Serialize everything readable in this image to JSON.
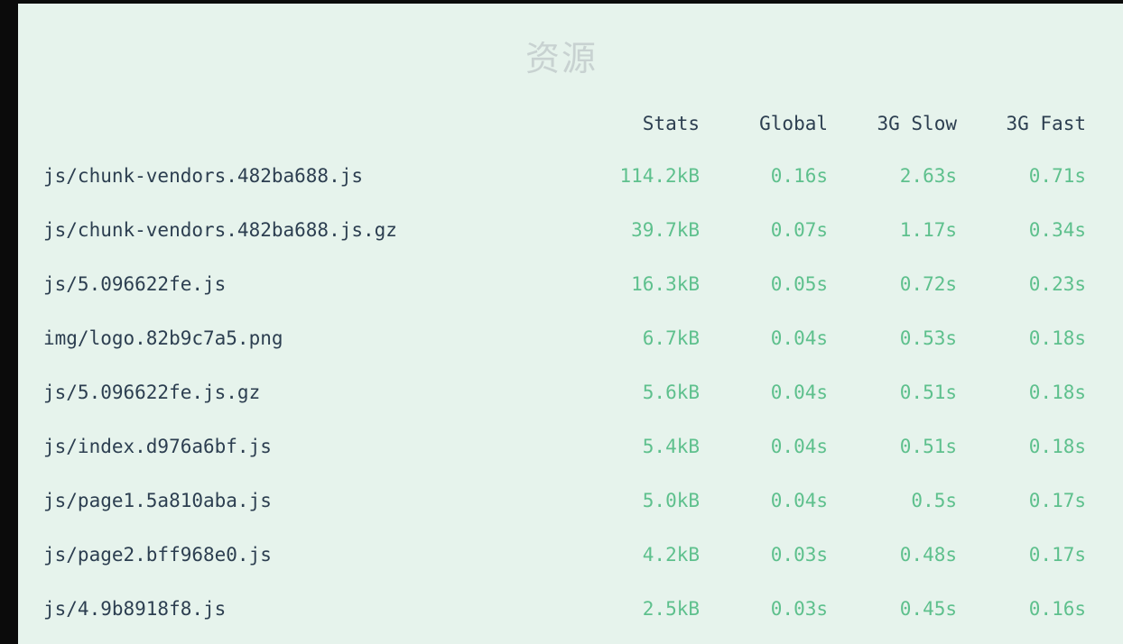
{
  "title": "资源",
  "columns": {
    "name": "",
    "stats": "Stats",
    "global": "Global",
    "slow3g": "3G Slow",
    "fast3g": "3G Fast"
  },
  "rows": [
    {
      "name": "js/chunk-vendors.482ba688.js",
      "stats": "114.2kB",
      "global": "0.16s",
      "slow3g": "2.63s",
      "fast3g": "0.71s"
    },
    {
      "name": "js/chunk-vendors.482ba688.js.gz",
      "stats": "39.7kB",
      "global": "0.07s",
      "slow3g": "1.17s",
      "fast3g": "0.34s"
    },
    {
      "name": "js/5.096622fe.js",
      "stats": "16.3kB",
      "global": "0.05s",
      "slow3g": "0.72s",
      "fast3g": "0.23s"
    },
    {
      "name": "img/logo.82b9c7a5.png",
      "stats": "6.7kB",
      "global": "0.04s",
      "slow3g": "0.53s",
      "fast3g": "0.18s"
    },
    {
      "name": "js/5.096622fe.js.gz",
      "stats": "5.6kB",
      "global": "0.04s",
      "slow3g": "0.51s",
      "fast3g": "0.18s"
    },
    {
      "name": "js/index.d976a6bf.js",
      "stats": "5.4kB",
      "global": "0.04s",
      "slow3g": "0.51s",
      "fast3g": "0.18s"
    },
    {
      "name": "js/page1.5a810aba.js",
      "stats": "5.0kB",
      "global": "0.04s",
      "slow3g": "0.5s",
      "fast3g": "0.17s"
    },
    {
      "name": "js/page2.bff968e0.js",
      "stats": "4.2kB",
      "global": "0.03s",
      "slow3g": "0.48s",
      "fast3g": "0.17s"
    },
    {
      "name": "js/4.9b8918f8.js",
      "stats": "2.5kB",
      "global": "0.03s",
      "slow3g": "0.45s",
      "fast3g": "0.16s"
    }
  ]
}
